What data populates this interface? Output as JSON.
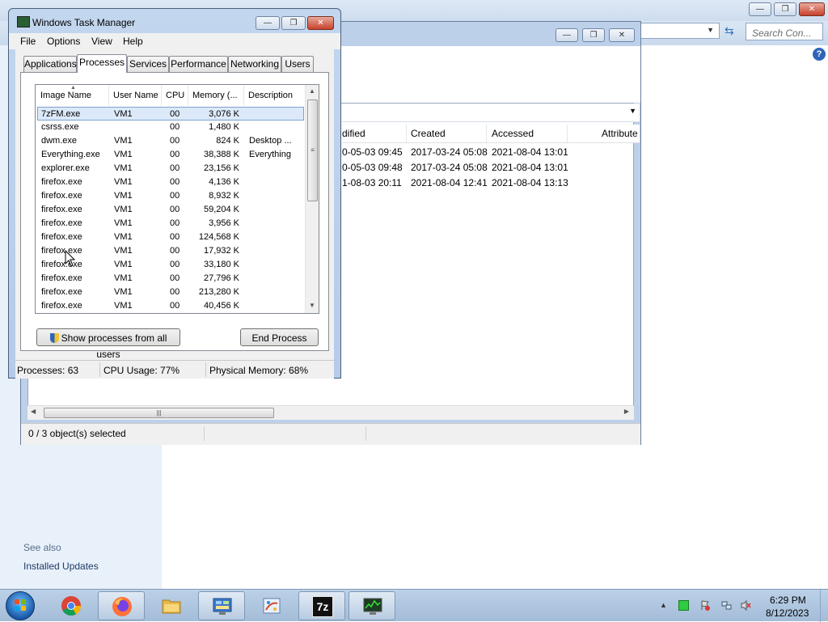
{
  "control_panel": {
    "search_placeholder": "Search Con...",
    "see_also": "See also",
    "installed_updates": "Installed Updates"
  },
  "zip": {
    "columns": [
      "dified",
      "Created",
      "Accessed",
      "Attribute"
    ],
    "rows": [
      {
        "modified": "0-05-03 09:45",
        "created": "2017-03-24 05:08",
        "accessed": "2021-08-04 13:01"
      },
      {
        "modified": "0-05-03 09:48",
        "created": "2017-03-24 05:08",
        "accessed": "2021-08-04 13:01"
      },
      {
        "modified": "1-08-03 20:11",
        "created": "2021-08-04 12:41",
        "accessed": "2021-08-04 13:13"
      }
    ],
    "status": "0 / 3 object(s) selected"
  },
  "task_manager": {
    "title": "Windows Task Manager",
    "menu": [
      "File",
      "Options",
      "View",
      "Help"
    ],
    "tabs": [
      "Applications",
      "Processes",
      "Services",
      "Performance",
      "Networking",
      "Users"
    ],
    "active_tab": "Processes",
    "columns": [
      "Image Name",
      "User Name",
      "CPU",
      "Memory (...",
      "Description"
    ],
    "processes": [
      {
        "name": "7zFM.exe",
        "user": "VM1",
        "cpu": "00",
        "mem": "3,076 K",
        "desc": ""
      },
      {
        "name": "csrss.exe",
        "user": "",
        "cpu": "00",
        "mem": "1,480 K",
        "desc": ""
      },
      {
        "name": "dwm.exe",
        "user": "VM1",
        "cpu": "00",
        "mem": "824 K",
        "desc": "Desktop ..."
      },
      {
        "name": "Everything.exe",
        "user": "VM1",
        "cpu": "00",
        "mem": "38,388 K",
        "desc": "Everything"
      },
      {
        "name": "explorer.exe",
        "user": "VM1",
        "cpu": "00",
        "mem": "23,156 K",
        "desc": ""
      },
      {
        "name": "firefox.exe",
        "user": "VM1",
        "cpu": "00",
        "mem": "4,136 K",
        "desc": ""
      },
      {
        "name": "firefox.exe",
        "user": "VM1",
        "cpu": "00",
        "mem": "8,932 K",
        "desc": ""
      },
      {
        "name": "firefox.exe",
        "user": "VM1",
        "cpu": "00",
        "mem": "59,204 K",
        "desc": ""
      },
      {
        "name": "firefox.exe",
        "user": "VM1",
        "cpu": "00",
        "mem": "3,956 K",
        "desc": ""
      },
      {
        "name": "firefox.exe",
        "user": "VM1",
        "cpu": "00",
        "mem": "124,568 K",
        "desc": ""
      },
      {
        "name": "firefox.exe",
        "user": "VM1",
        "cpu": "00",
        "mem": "17,932 K",
        "desc": ""
      },
      {
        "name": "firefox.exe",
        "user": "VM1",
        "cpu": "00",
        "mem": "33,180 K",
        "desc": ""
      },
      {
        "name": "firefox.exe",
        "user": "VM1",
        "cpu": "00",
        "mem": "27,796 K",
        "desc": ""
      },
      {
        "name": "firefox.exe",
        "user": "VM1",
        "cpu": "00",
        "mem": "213,280 K",
        "desc": ""
      },
      {
        "name": "firefox.exe",
        "user": "VM1",
        "cpu": "00",
        "mem": "40,456 K",
        "desc": ""
      }
    ],
    "show_all_label": "Show processes from all users",
    "end_process_label": "End Process",
    "status": {
      "processes": "Processes: 63",
      "cpu": "CPU Usage: 77%",
      "memory": "Physical Memory: 68%"
    }
  },
  "taskbar": {
    "items": [
      "chrome-icon",
      "firefox-icon",
      "folder-icon",
      "control-panel-icon",
      "paint-icon",
      "7zip-icon",
      "task-manager-icon"
    ],
    "zip_label": "7z",
    "time": "6:29 PM",
    "date": "8/12/2023"
  },
  "colors": {
    "selection": "#dce9f9",
    "taskbar": "#a3bcd8",
    "close_button": "#c7412b"
  }
}
